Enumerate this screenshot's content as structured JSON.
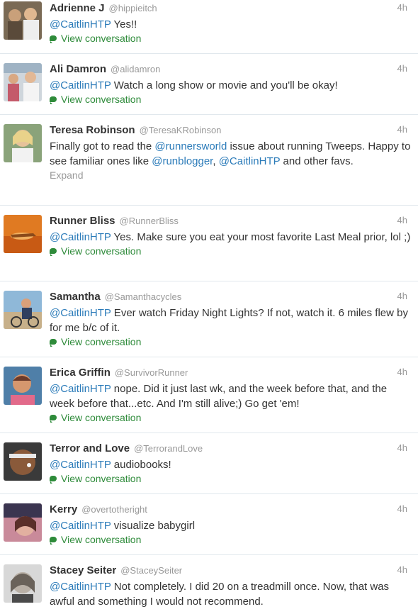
{
  "tweets": [
    {
      "name": "Adrienne J",
      "handle": "@hippieitch",
      "time": "4h",
      "mention": "@CaitlinHTP",
      "text": " Yes!!",
      "action": "View conversation"
    },
    {
      "name": "Ali Damron",
      "handle": "@alidamron",
      "time": "4h",
      "mention": "@CaitlinHTP",
      "text": " Watch a long show or movie and you'll be okay!",
      "action": "View conversation"
    },
    {
      "name": "Teresa Robinson",
      "handle": "@TeresaKRobinson",
      "time": "4h",
      "text_a": "Finally got to read the ",
      "mention_a": "@runnersworld",
      "text_b": " issue about running Tweeps. Happy to see familiar ones like ",
      "mention_b": "@runblogger",
      "text_c": ", ",
      "mention_c": "@CaitlinHTP",
      "text_d": " and other favs.",
      "action": "Expand"
    },
    {
      "name": "Runner Bliss",
      "handle": "@RunnerBliss",
      "time": "4h",
      "mention": "@CaitlinHTP",
      "text": " Yes. Make sure you eat your most favorite Last Meal prior, lol ;)",
      "action": "View conversation"
    },
    {
      "name": "Samantha",
      "handle": "@Samanthacycles",
      "time": "4h",
      "mention": "@CaitlinHTP",
      "text": " Ever watch Friday Night Lights? If not, watch it. 6 miles flew by for me b/c of it.",
      "action": "View conversation"
    },
    {
      "name": "Erica Griffin",
      "handle": "@SurvivorRunner",
      "time": "4h",
      "mention": "@CaitlinHTP",
      "text": " nope. Did it just last wk, and the week before that, and the week before that...etc. And I'm still alive;) Go get 'em!",
      "action": "View conversation"
    },
    {
      "name": "Terror and Love",
      "handle": "@TerrorandLove",
      "time": "4h",
      "mention": "@CaitlinHTP",
      "text": " audiobooks!",
      "action": "View conversation"
    },
    {
      "name": "Kerry",
      "handle": "@overtotheright",
      "time": "4h",
      "mention": "@CaitlinHTP",
      "text": " visualize babygirl",
      "action": "View conversation"
    },
    {
      "name": "Stacey Seiter",
      "handle": "@StaceySeiter",
      "time": "4h",
      "mention": "@CaitlinHTP",
      "text": " Not completely. I did 20 on a treadmill once. Now, that was awful and something I would not recommend."
    }
  ]
}
